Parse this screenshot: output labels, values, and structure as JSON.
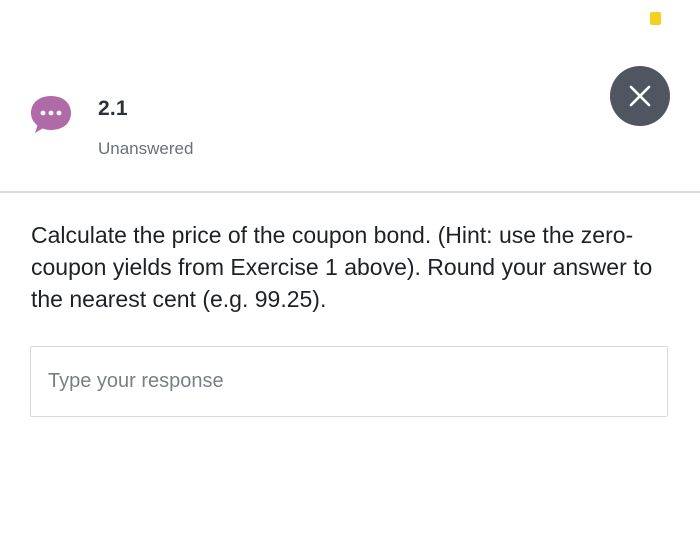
{
  "question": {
    "number": "2.1",
    "status": "Unanswered",
    "prompt": "Calculate the price of the coupon bond. (Hint: use the zero-coupon yields from Exercise 1 above). Round your answer to the nearest cent (e.g. 99.25)."
  },
  "response": {
    "value": "",
    "placeholder": "Type your response"
  },
  "icons": {
    "avatar": "chat-bubble-ellipsis-icon",
    "close": "close-icon",
    "status_indicator": "status-dot"
  },
  "colors": {
    "avatar_purple": "#b06aa7",
    "close_button_bg": "#4f5661",
    "status_dot": "#f5d021",
    "divider": "#d9dbdf"
  }
}
